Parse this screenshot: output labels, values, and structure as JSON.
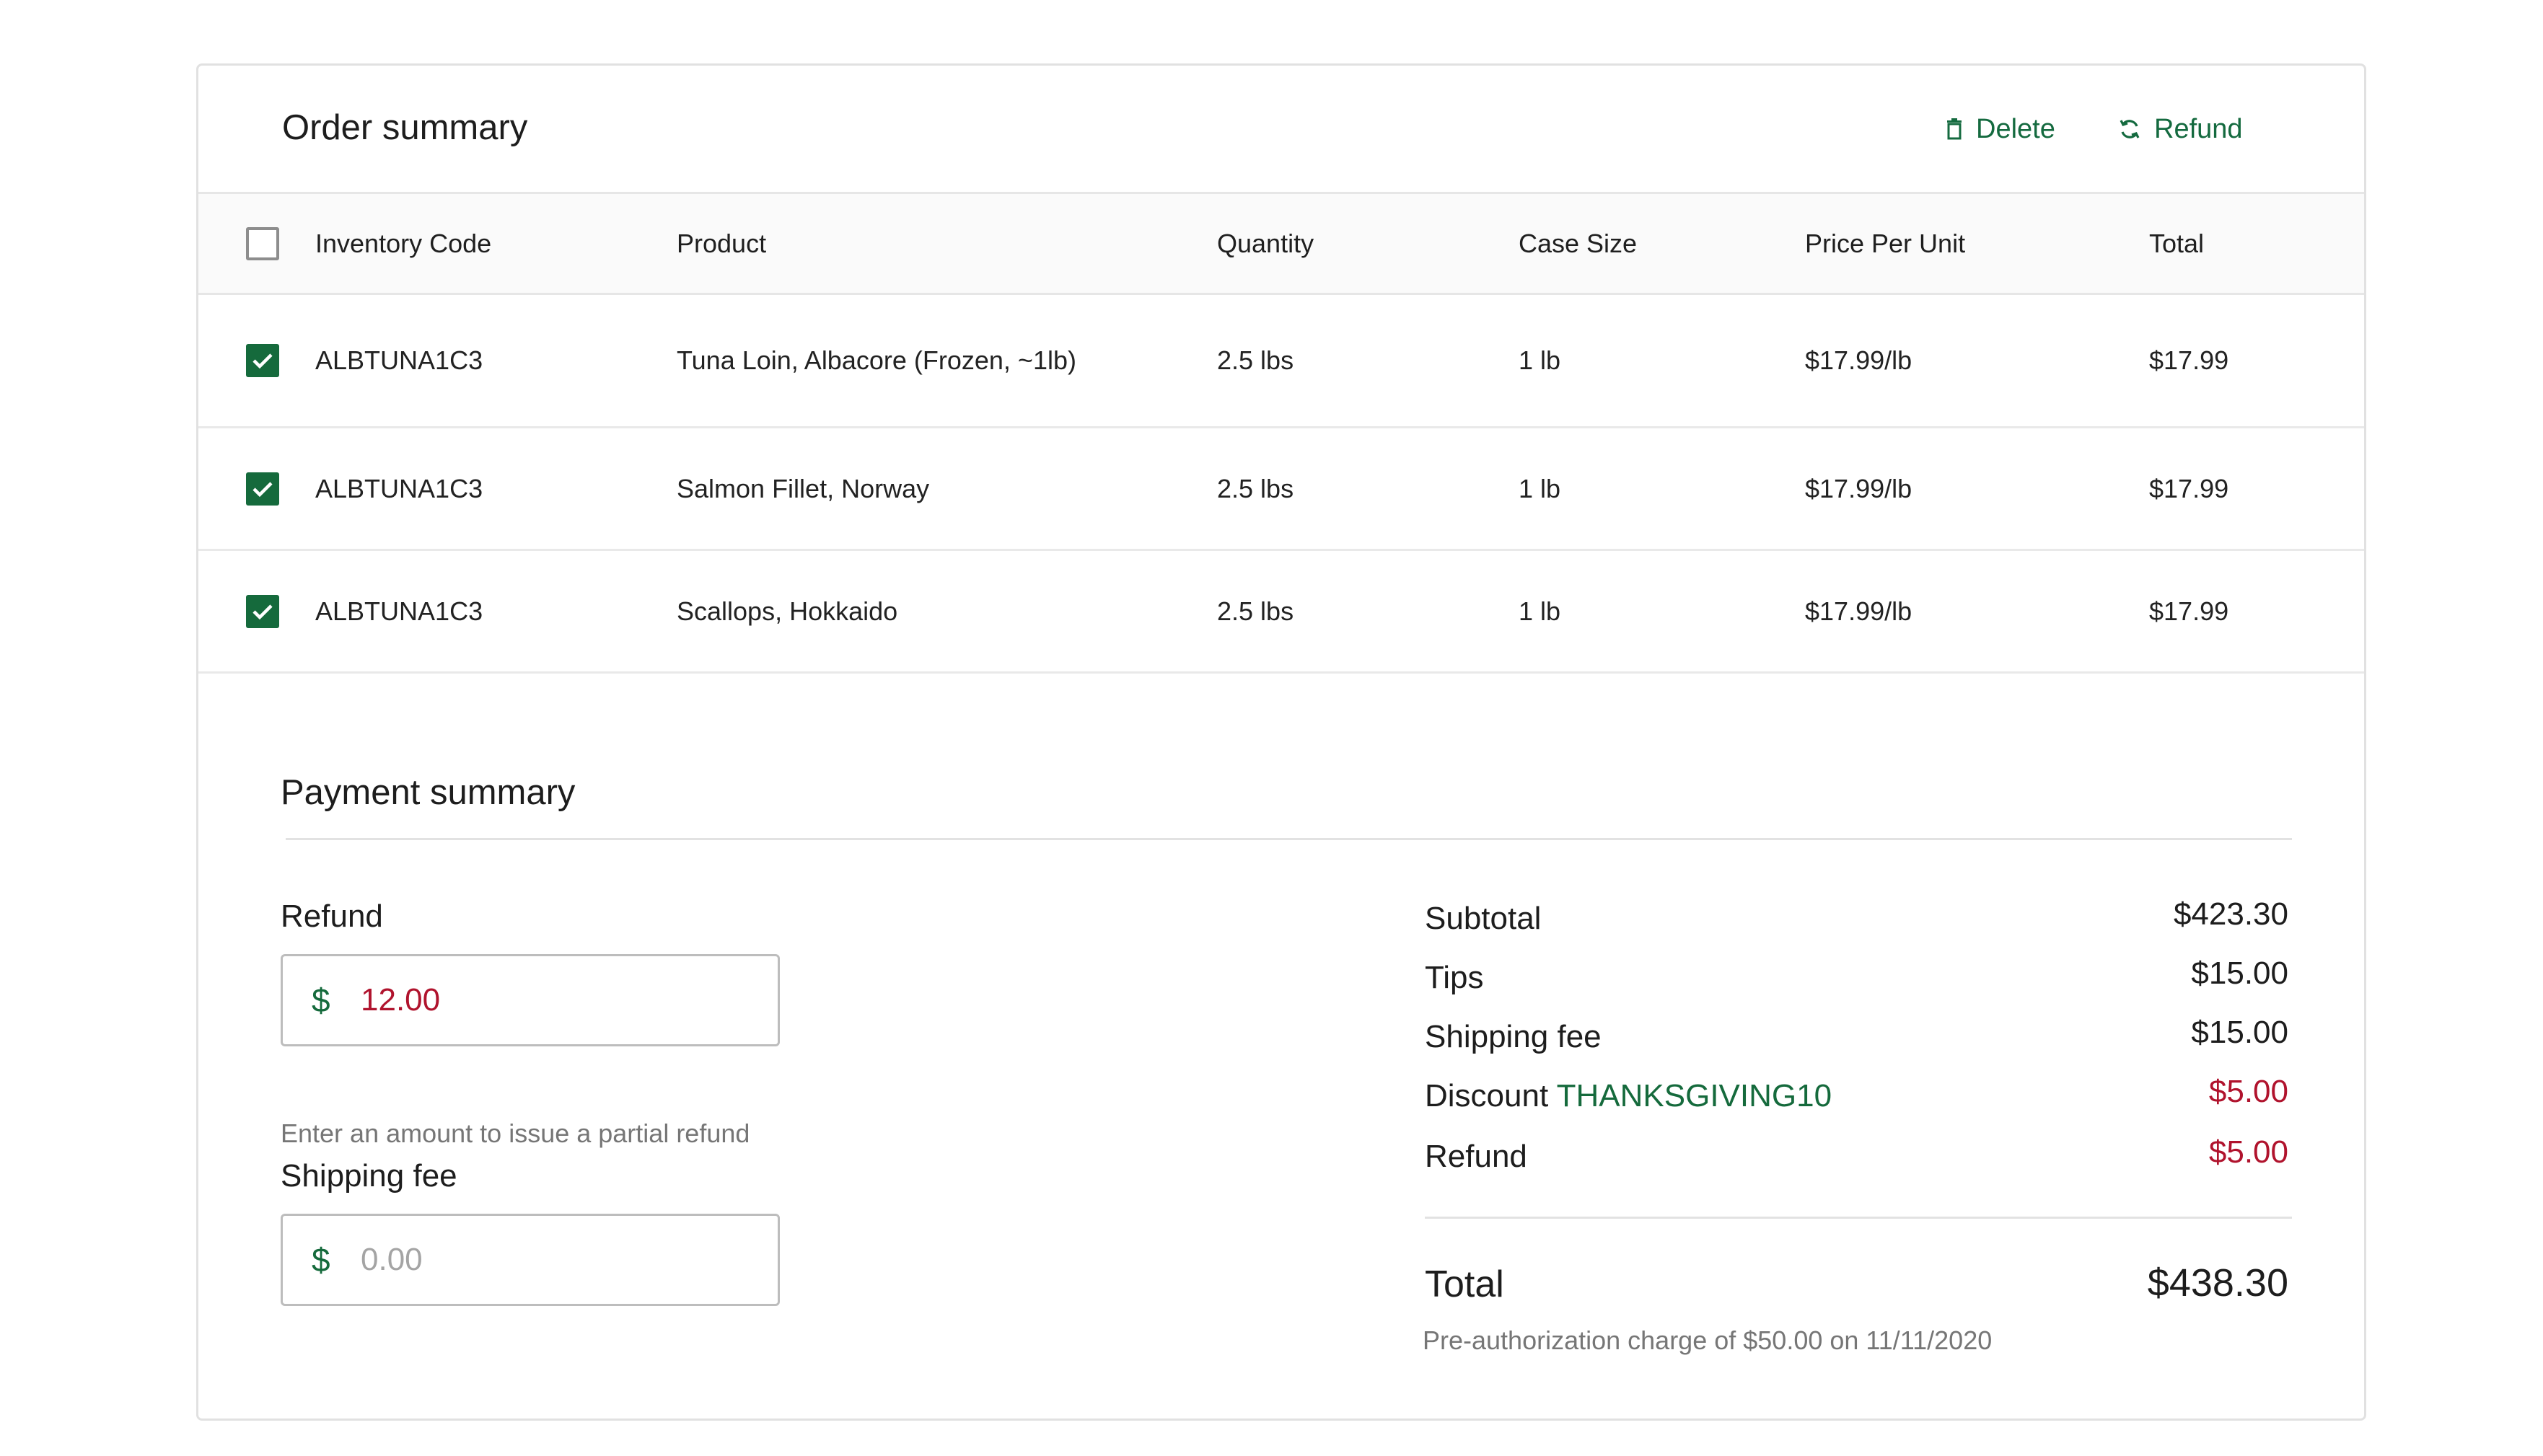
{
  "order_summary": {
    "title": "Order summary",
    "actions": {
      "delete_label": "Delete",
      "refund_label": "Refund"
    },
    "table": {
      "headers": {
        "inventory_code": "Inventory Code",
        "product": "Product",
        "quantity": "Quantity",
        "case_size": "Case Size",
        "price_per_unit": "Price Per Unit",
        "total": "Total"
      },
      "select_all_checked": false,
      "rows": [
        {
          "checked": true,
          "inventory_code": "ALBTUNA1C3",
          "product": "Tuna Loin, Albacore (Frozen, ~1lb)",
          "quantity": "2.5 lbs",
          "case_size": "1 lb",
          "price_per_unit": "$17.99/lb",
          "total": "$17.99"
        },
        {
          "checked": true,
          "inventory_code": "ALBTUNA1C3",
          "product": "Salmon Fillet, Norway",
          "quantity": "2.5 lbs",
          "case_size": "1 lb",
          "price_per_unit": "$17.99/lb",
          "total": "$17.99"
        },
        {
          "checked": true,
          "inventory_code": "ALBTUNA1C3",
          "product": "Scallops, Hokkaido",
          "quantity": "2.5 lbs",
          "case_size": "1 lb",
          "price_per_unit": "$17.99/lb",
          "total": "$17.99"
        }
      ]
    }
  },
  "payment_summary": {
    "title": "Payment summary",
    "refund_field": {
      "label": "Refund",
      "currency": "$",
      "value": "12.00",
      "helper": "Enter an amount to issue a partial refund"
    },
    "shipping_field": {
      "label": "Shipping fee",
      "currency": "$",
      "placeholder": "0.00"
    },
    "lines": {
      "subtotal_label": "Subtotal",
      "subtotal_value": "$423.30",
      "tips_label": "Tips",
      "tips_value": "$15.00",
      "shipping_label": "Shipping fee",
      "shipping_value": "$15.00",
      "discount_label": "Discount",
      "discount_code": "THANKSGIVING10",
      "discount_value": "$5.00",
      "refund_label": "Refund",
      "refund_value": "$5.00"
    },
    "total_label": "Total",
    "total_value": "$438.30",
    "preauth_note": "Pre-authorization charge of $50.00 on 11/11/2020"
  },
  "colors": {
    "accent_green": "#156a3c",
    "negative_red": "#b0132d"
  }
}
